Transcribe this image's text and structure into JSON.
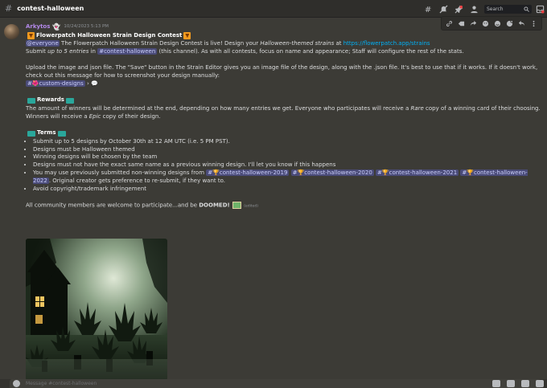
{
  "header": {
    "channel": "contest-halloween",
    "search_placeholder": "Search"
  },
  "header_icons": [
    "threads-icon",
    "mute-icon",
    "pin-icon",
    "members-icon",
    "search-icon",
    "inbox-icon",
    "help-icon"
  ],
  "message_actions": [
    "link-icon",
    "reply-icon",
    "forward-icon",
    "apps-icon",
    "reaction-icon",
    "super-reaction-icon",
    "reply-arrow-icon",
    "more-icon"
  ],
  "message": {
    "author": "Arkytos",
    "author_emoji": "👻",
    "timestamp": "10/24/2023 5:13 PM",
    "title": "Flowerpatch Halloween Strain Design Contest",
    "intro": {
      "mention": "@everyone",
      "t1": " The Flowerpatch Halloween Strain Design Contest is live! Design your ",
      "t2": "Halloween-themed strains",
      "t3": " at ",
      "link": "https://flowerpatch.app/strains",
      "line2_a": "Submit ",
      "line2_b": "up to 5 entries",
      "line2_c": " in ",
      "channel": "#contest-halloween",
      "line2_d": " (this channel). As with all contests, focus on name and appearance; Staff will configure the rest of the stats."
    },
    "upload": {
      "text": "Upload the image and json file. The \"Save\" button in the Strain Editor gives you an image file of the design, along with the .json file.  It's best to use that if it works. If it doesn't work, check out this message for how to screenshot your design manually:",
      "channel_link": "#🌺custom-designs",
      "arrow": "›",
      "chat_icon": "💬"
    },
    "rewards": {
      "heading": "Rewards",
      "a": "The amount of winners will be determined at the end, depending on how many entries we get. Everyone who participates will receive a ",
      "rare": "Rare",
      "b": " copy of a winning card of their choosing. Winners will receive a ",
      "epic": "Epic",
      "c": " copy of their design."
    },
    "terms": {
      "heading": "Terms",
      "items": [
        "Submit up to 5 designs by October 30th at 12 AM UTC (i.e. 5 PM PST).",
        "Designs must be Halloween themed",
        "Winning designs will be chosen by the team",
        "Designs must not have the exact same name as a previous winning design. I'll let you know if this happens"
      ],
      "prev_text": "You may use previously submitted non-winning designs from ",
      "prev_channels": [
        "#🏆contest-halloween-2019",
        "#🏆contest-halloween-2020",
        "#🏆contest-halloween-2021",
        "#🏆contest-halloween-2022"
      ],
      "prev_tail": ". Original creator gets preference to re-submit, if they want to.",
      "last": "Avoid copyright/trademark infringement"
    },
    "closing": {
      "text": "All community members are welcome to participate...and be ",
      "bold": "DOOMED",
      "excl": "!",
      "edited": "(edited)"
    }
  },
  "composer": {
    "placeholder": "Message #contest-halloween"
  },
  "colors": {
    "background": "#3c3b36",
    "username": "#b288e8",
    "link": "#00aff4",
    "mention_bg": "#4a4b78"
  }
}
